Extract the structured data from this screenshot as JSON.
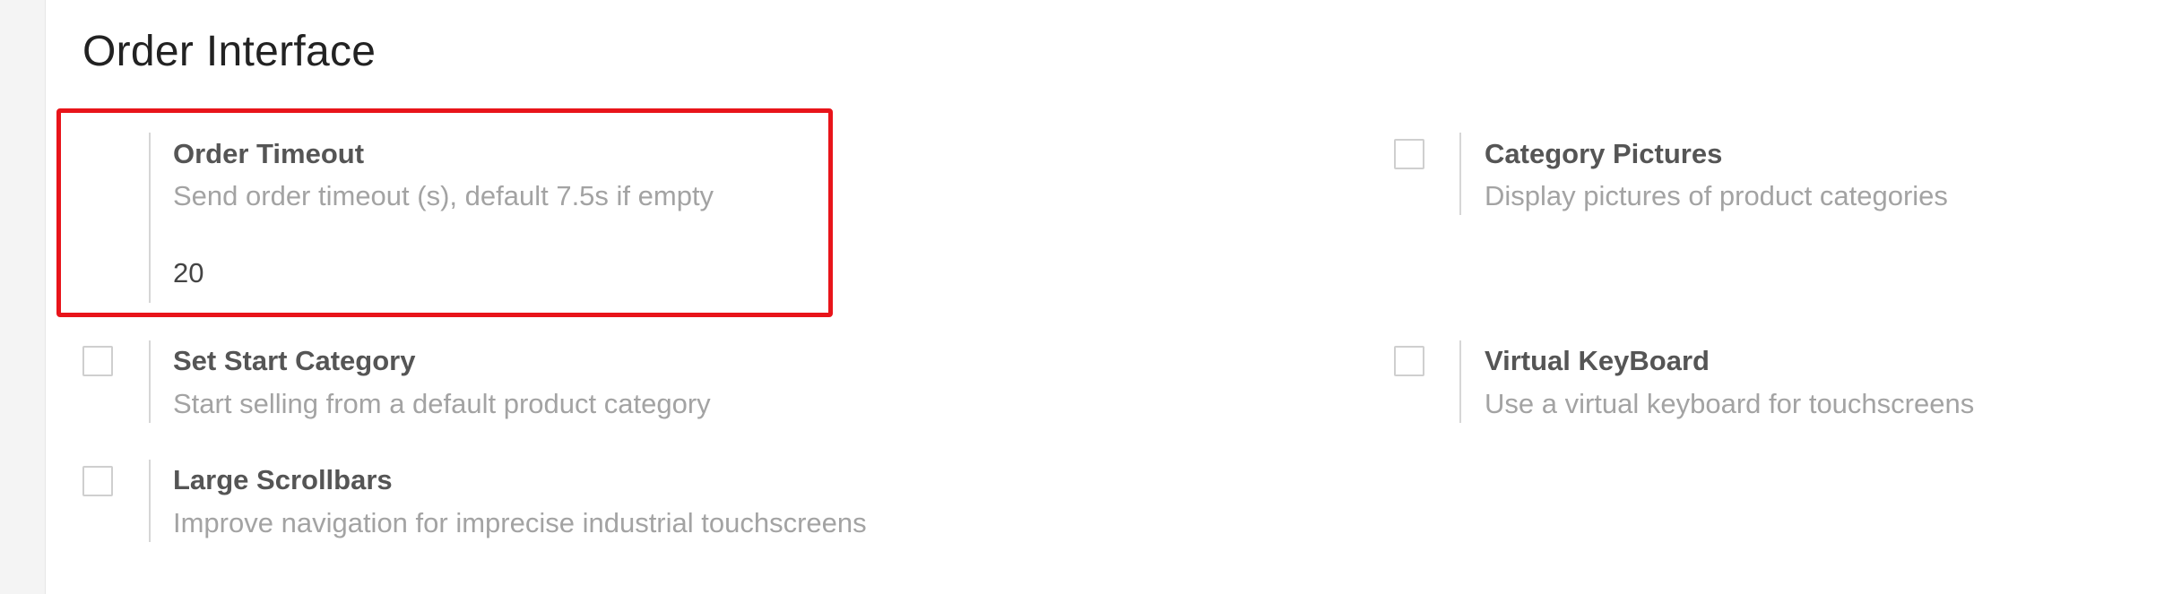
{
  "section": {
    "title": "Order Interface"
  },
  "settings": {
    "order_timeout": {
      "label": "Order Timeout",
      "description": "Send order timeout (s), default 7.5s if empty",
      "value": "20"
    },
    "category_pictures": {
      "label": "Category Pictures",
      "description": "Display pictures of product categories",
      "checked": false
    },
    "set_start_category": {
      "label": "Set Start Category",
      "description": "Start selling from a default product category",
      "checked": false
    },
    "virtual_keyboard": {
      "label": "Virtual KeyBoard",
      "description": "Use a virtual keyboard for touchscreens",
      "checked": false
    },
    "large_scrollbars": {
      "label": "Large Scrollbars",
      "description": "Improve navigation for imprecise industrial touchscreens",
      "checked": false
    }
  },
  "colors": {
    "highlight": "#e8141a",
    "label": "#555555",
    "description": "#a3a3a3"
  }
}
